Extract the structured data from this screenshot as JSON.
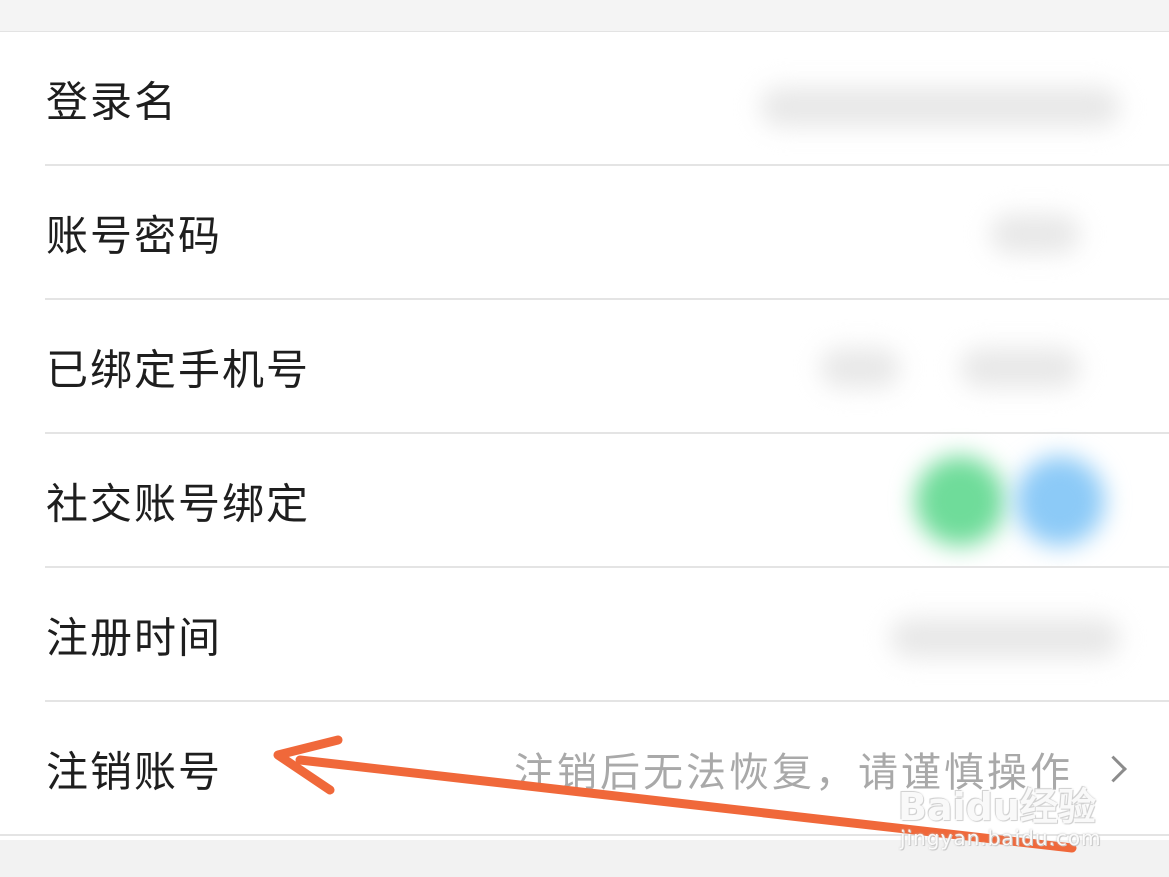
{
  "rows": [
    {
      "label": "登录名"
    },
    {
      "label": "账号密码"
    },
    {
      "label": "已绑定手机号"
    },
    {
      "label": "社交账号绑定"
    },
    {
      "label": "注册时间"
    },
    {
      "label": "注销账号",
      "hint": "注销后无法恢复，请谨慎操作"
    }
  ],
  "watermark": {
    "logo": "Baidu经验",
    "url": "jingyan.baidu.com"
  },
  "colors": {
    "arrow": "#f0683a",
    "social_green": "#6fdc9a",
    "social_blue": "#8ccaf7"
  }
}
